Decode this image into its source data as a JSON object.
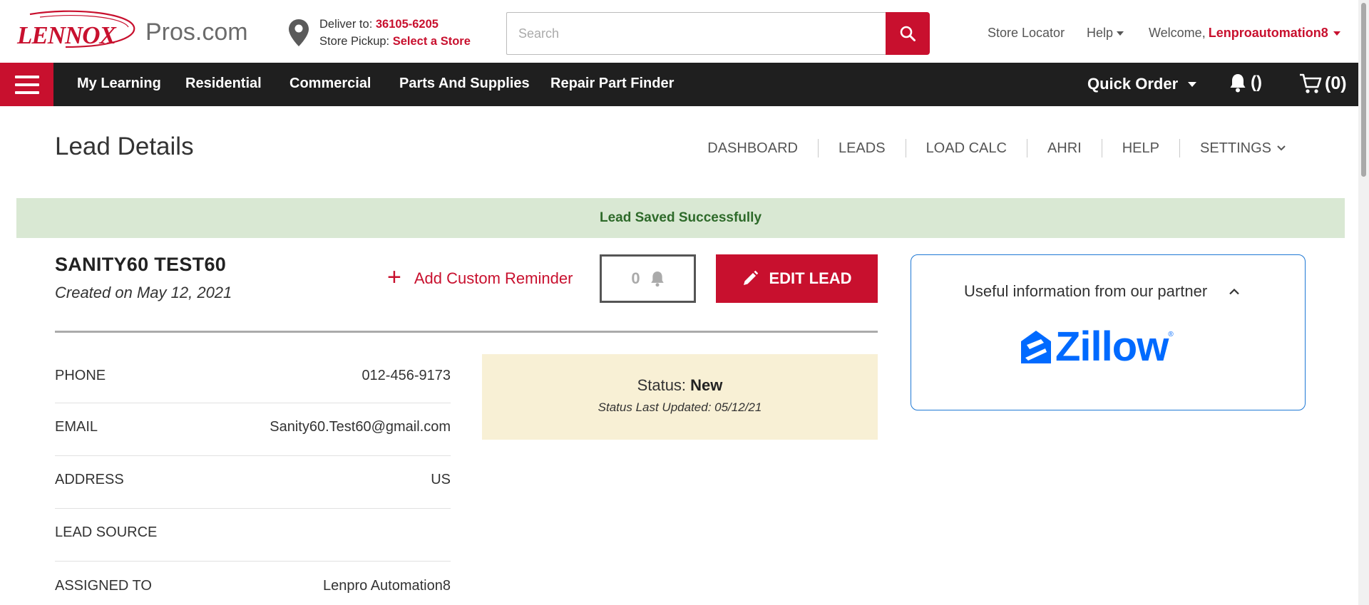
{
  "header": {
    "logo_brand": "LENNOX",
    "logo_site": "Pros.com",
    "deliver_label": "Deliver to:",
    "deliver_zip": "36105-6205",
    "pickup_label": "Store Pickup:",
    "pickup_link": "Select a Store",
    "search_placeholder": "Search",
    "store_locator": "Store Locator",
    "help": "Help",
    "welcome_label": "Welcome,",
    "username": "Lenproautomation8"
  },
  "nav": {
    "items": [
      "My Learning",
      "Residential",
      "Commercial",
      "Parts And Supplies",
      "Repair Part Finder"
    ],
    "quick_order": "Quick Order",
    "notifications": "()",
    "cart": "(0)"
  },
  "page": {
    "title": "Lead Details",
    "subnav": [
      "DASHBOARD",
      "LEADS",
      "LOAD CALC",
      "AHRI",
      "HELP",
      "SETTINGS"
    ]
  },
  "alert": {
    "message": "Lead Saved Successfully"
  },
  "lead": {
    "name": "SANITY60 TEST60",
    "created": "Created on May 12, 2021",
    "add_reminder": "Add Custom Reminder",
    "reminder_count": "0",
    "edit_button": "EDIT LEAD",
    "details": [
      {
        "label": "PHONE",
        "value": "012-456-9173"
      },
      {
        "label": "EMAIL",
        "value": "Sanity60.Test60@gmail.com"
      },
      {
        "label": "ADDRESS",
        "value": "US"
      },
      {
        "label": "LEAD SOURCE",
        "value": ""
      },
      {
        "label": "ASSIGNED TO",
        "value": "Lenpro Automation8"
      }
    ],
    "status_label": "Status:",
    "status_value": "New",
    "status_updated": "Status Last Updated: 05/12/21"
  },
  "partner": {
    "heading": "Useful information from our partner",
    "brand": "Zillow",
    "reg_mark": "®"
  },
  "colors": {
    "brand_red": "#c8102e",
    "nav_dark": "#1f1f1f",
    "success_bg": "#d9e8d3",
    "success_text": "#2e6a2a",
    "status_bg": "#f8f0d5",
    "zillow_blue": "#006aff"
  }
}
